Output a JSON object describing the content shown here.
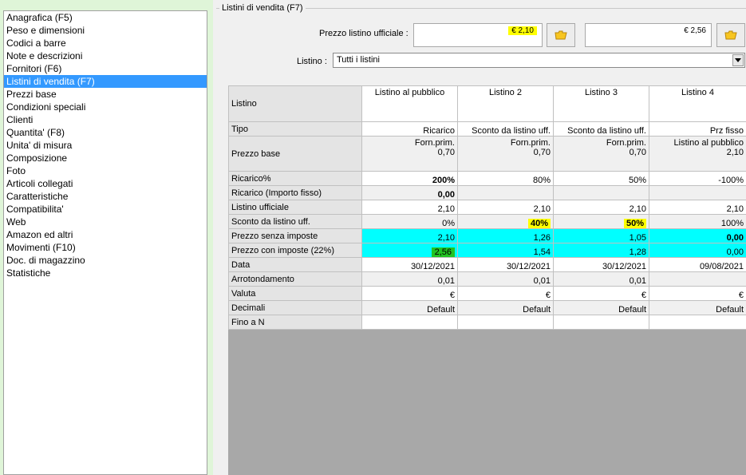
{
  "sidebar": {
    "items": [
      {
        "label": "Anagrafica (F5)"
      },
      {
        "label": "Peso e dimensioni"
      },
      {
        "label": "Codici a barre"
      },
      {
        "label": "Note e descrizioni"
      },
      {
        "label": "Fornitori (F6)"
      },
      {
        "label": "Listini di vendita (F7)",
        "selected": true
      },
      {
        "label": "Prezzi base"
      },
      {
        "label": "Condizioni speciali"
      },
      {
        "label": "Clienti"
      },
      {
        "label": "Quantita' (F8)"
      },
      {
        "label": "Unita' di misura"
      },
      {
        "label": "Composizione"
      },
      {
        "label": "Foto"
      },
      {
        "label": "Articoli collegati"
      },
      {
        "label": "Caratteristiche"
      },
      {
        "label": "Compatibilita'"
      },
      {
        "label": "Web"
      },
      {
        "label": "Amazon ed altri"
      },
      {
        "label": "Movimenti (F10)"
      },
      {
        "label": "Doc. di magazzino"
      },
      {
        "label": "Statistiche"
      }
    ]
  },
  "panel": {
    "group_title": "Listini di vendita (F7)",
    "prezzo_label": "Prezzo listino ufficiale :",
    "prezzo_value_1": "€ 2,10",
    "prezzo_value_2": "€ 2,56",
    "listino_label": "Listino :",
    "listino_value": "Tutti i listini"
  },
  "grid": {
    "corner": "Listino",
    "columns": [
      "Listino al pubblico",
      "Listino 2",
      "Listino 3",
      "Listino 4"
    ],
    "rows": {
      "tipo": {
        "label": "Tipo",
        "values": [
          "Ricarico",
          "Sconto da listino uff.",
          "Sconto da listino uff.",
          "Prz fisso"
        ]
      },
      "prezzo_base": {
        "label": "Prezzo base",
        "line1": [
          "Forn.prim.",
          "Forn.prim.",
          "Forn.prim.",
          "Listino al pubblico"
        ],
        "line2": [
          "0,70",
          "0,70",
          "0,70",
          "2,10"
        ]
      },
      "ricarico_pct": {
        "label": "Ricarico%",
        "values": [
          "200%",
          "80%",
          "50%",
          "-100%"
        ]
      },
      "ricarico_fisso": {
        "label": "Ricarico (Importo fisso)",
        "values": [
          "0,00",
          "",
          "",
          ""
        ]
      },
      "listino_ufficiale": {
        "label": "Listino ufficiale",
        "values": [
          "2,10",
          "2,10",
          "2,10",
          "2,10"
        ]
      },
      "sconto": {
        "label": "Sconto da listino uff.",
        "values": [
          "0%",
          "40%",
          "50%",
          "100%"
        ]
      },
      "senza_imposte": {
        "label": "Prezzo senza imposte",
        "values": [
          "2,10",
          "1,26",
          "1,05",
          "0,00"
        ]
      },
      "con_imposte": {
        "label": "Prezzo con imposte (22%)",
        "values": [
          "2,56",
          "1,54",
          "1,28",
          "0,00"
        ]
      },
      "data": {
        "label": "Data",
        "values": [
          "30/12/2021",
          "30/12/2021",
          "30/12/2021",
          "09/08/2021"
        ]
      },
      "arrotondamento": {
        "label": "Arrotondamento",
        "values": [
          "0,01",
          "0,01",
          "0,01",
          ""
        ]
      },
      "valuta": {
        "label": "Valuta",
        "values": [
          "€",
          "€",
          "€",
          "€"
        ]
      },
      "decimali": {
        "label": "Decimali",
        "values": [
          "Default",
          "Default",
          "Default",
          "Default"
        ]
      },
      "fino_a_n": {
        "label": "Fino a N",
        "values": [
          "",
          "",
          "",
          ""
        ]
      }
    }
  },
  "colors": {
    "selection": "#3399ff",
    "highlight_yellow": "#ffff00",
    "highlight_cyan": "#00ffff",
    "highlight_green": "#22c322",
    "background": "#dff5d8"
  }
}
